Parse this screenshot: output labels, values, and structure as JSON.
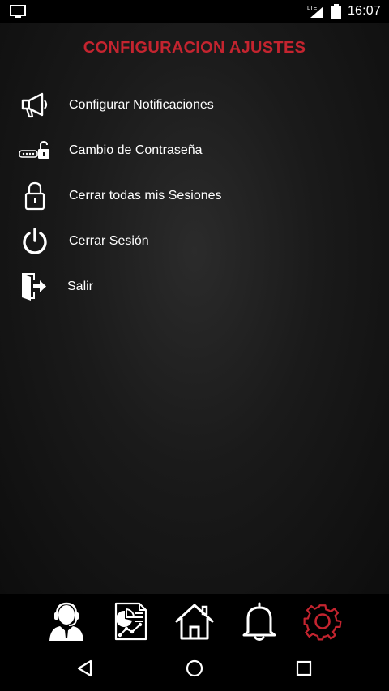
{
  "status_bar": {
    "time": "16:07",
    "network": "LTE",
    "left_icon": "tv-icon"
  },
  "page": {
    "title": "CONFIGURACION AJUSTES"
  },
  "menu": {
    "items": [
      {
        "label": "Configurar Notificaciones",
        "icon": "megaphone-icon"
      },
      {
        "label": "Cambio de Contraseña",
        "icon": "password-unlock-icon"
      },
      {
        "label": "Cerrar todas mis Sesiones",
        "icon": "lock-icon"
      },
      {
        "label": "Cerrar Sesión",
        "icon": "power-icon"
      },
      {
        "label": "Salir",
        "icon": "exit-door-icon"
      }
    ]
  },
  "bottom_nav": {
    "items": [
      {
        "icon": "support-agent-icon",
        "active": false
      },
      {
        "icon": "report-chart-icon",
        "active": false
      },
      {
        "icon": "home-icon",
        "active": false
      },
      {
        "icon": "bell-icon",
        "active": false
      },
      {
        "icon": "gear-icon",
        "active": true
      }
    ],
    "active_color": "#c4242f"
  },
  "colors": {
    "accent": "#c4242f",
    "text": "#ffffff",
    "background": "#000000"
  }
}
